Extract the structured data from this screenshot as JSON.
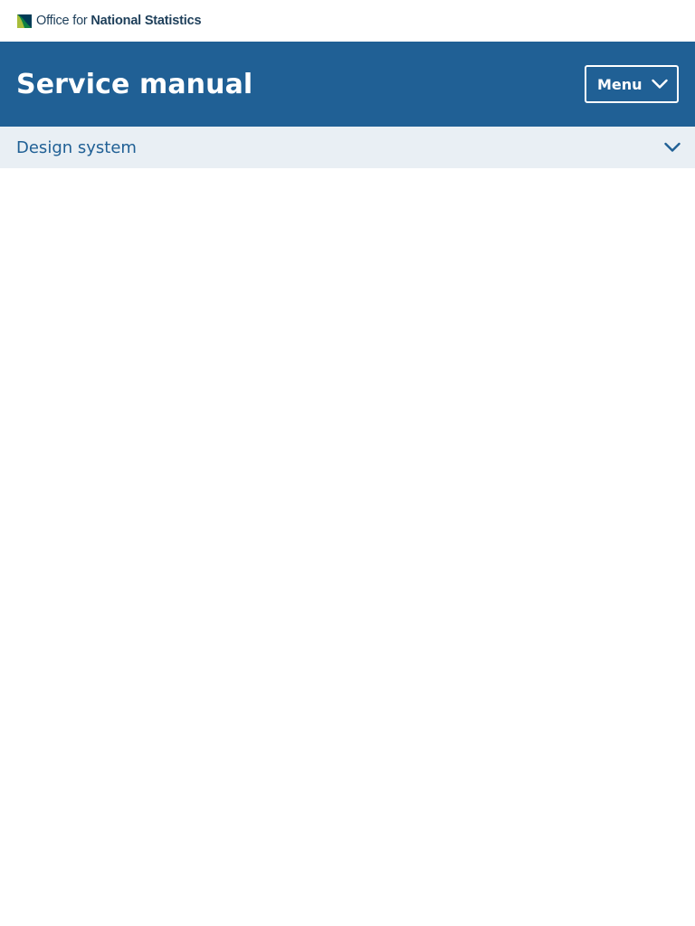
{
  "brand": {
    "text_light": "Office for",
    "text_bold": "National Statistics",
    "logo_icon": "ons-logo-icon"
  },
  "header": {
    "title": "Service manual",
    "menu_label": "Menu",
    "menu_icon": "chevron-down-icon"
  },
  "subnav": {
    "label": "Design system",
    "toggle_icon": "chevron-down-icon"
  },
  "colors": {
    "header_bg": "#206095",
    "subnav_bg": "#e9eff4",
    "subnav_text": "#206095",
    "logo_dark": "#003c57",
    "logo_green": "#a8bd3a"
  }
}
